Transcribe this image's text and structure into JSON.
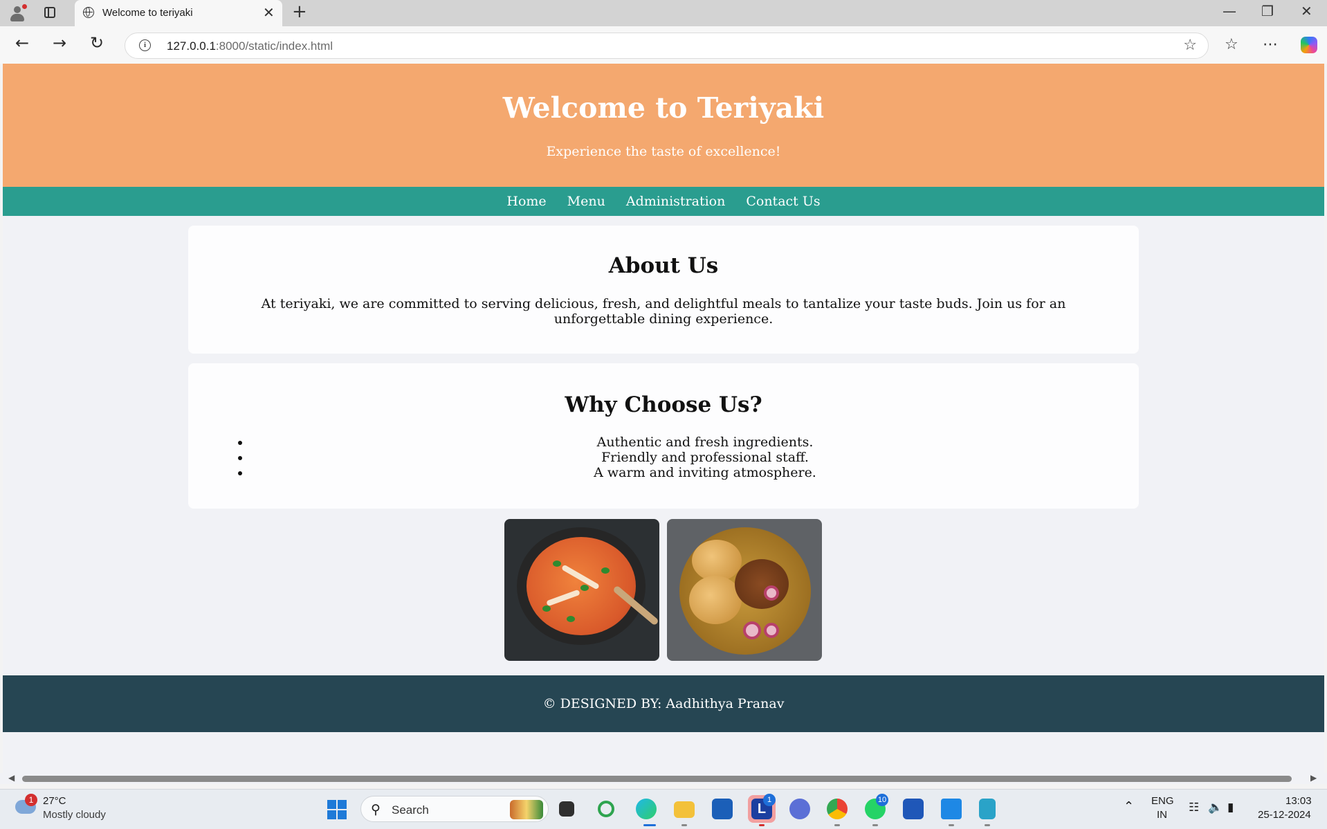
{
  "browser": {
    "tab_title": "Welcome to teriyaki",
    "new_tab": "+",
    "close_tab": "✕",
    "url_host": "127.0.0.1",
    "url_rest": ":8000/static/index.html",
    "window_controls": {
      "minimize": "—",
      "restore": "❐",
      "close": "✕"
    }
  },
  "page": {
    "title": "Welcome to Teriyaki",
    "subtitle": "Experience the taste of excellence!",
    "nav": [
      "Home",
      "Menu",
      "Administration",
      "Contact Us"
    ],
    "about": {
      "heading": "About Us",
      "text": "At teriyaki, we are committed to serving delicious, fresh, and delightful meals to tantalize your taste buds. Join us for an unforgettable dining experience."
    },
    "why": {
      "heading": "Why Choose Us?",
      "items": [
        "Authentic and fresh ingredients.",
        "Friendly and professional staff.",
        "A warm and inviting atmosphere."
      ]
    },
    "footer": "© DESIGNED BY: Aadhithya Pranav"
  },
  "taskbar": {
    "weather_badge": "1",
    "temperature": "27°C",
    "weather": "Mostly cloudy",
    "search": "Search",
    "teams_badge": "1",
    "whatsapp_badge": "10",
    "lang1": "ENG",
    "lang2": "IN",
    "time": "13:03",
    "date": "25-12-2024"
  },
  "colors": {
    "header": "#f4a86f",
    "nav": "#2a9d8f",
    "footer": "#264653",
    "page_bg": "#f1f2f6"
  }
}
